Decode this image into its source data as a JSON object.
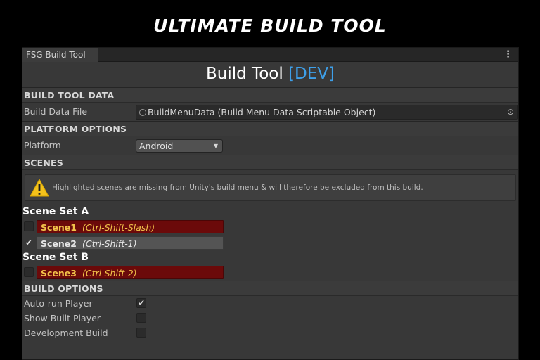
{
  "banner": {
    "title": "ULTIMATE BUILD TOOL"
  },
  "window": {
    "tab_label": "FSG Build Tool",
    "menu_glyph": "⋮",
    "title_main": "Build Tool ",
    "title_tag": "[DEV]",
    "accent_color": "#3ea0ea"
  },
  "sections": {
    "build_tool_data": "BUILD TOOL DATA",
    "platform_options": "PLATFORM OPTIONS",
    "scenes": "SCENES",
    "build_options": "BUILD OPTIONS"
  },
  "build_data": {
    "label": "Build Data File",
    "value": "BuildMenuData (Build Menu Data Scriptable Object)",
    "picker_icon": "target-icon"
  },
  "platform": {
    "label": "Platform",
    "selected": "Android"
  },
  "warning": {
    "icon": "warning-icon",
    "text": "Highlighted scenes are missing from Unity's build menu & will therefore be excluded from this build."
  },
  "scene_sets": [
    {
      "name": "Scene Set A",
      "scenes": [
        {
          "name": "Scene1",
          "shortcut": "(Ctrl-Shift-Slash)",
          "checked": false,
          "missing": true
        },
        {
          "name": "Scene2",
          "shortcut": "(Ctrl-Shift-1)",
          "checked": true,
          "missing": false
        }
      ]
    },
    {
      "name": "Scene Set B",
      "scenes": [
        {
          "name": "Scene3",
          "shortcut": "(Ctrl-Shift-2)",
          "checked": false,
          "missing": true
        }
      ]
    }
  ],
  "build_options": [
    {
      "label": "Auto-run Player",
      "checked": true
    },
    {
      "label": "Show Built Player",
      "checked": false
    },
    {
      "label": "Development Build",
      "checked": false
    }
  ],
  "glyphs": {
    "check": "✔",
    "caret": "▼"
  },
  "colors": {
    "missing_bg": "#6b0a0a",
    "missing_text": "#f2c24a"
  }
}
